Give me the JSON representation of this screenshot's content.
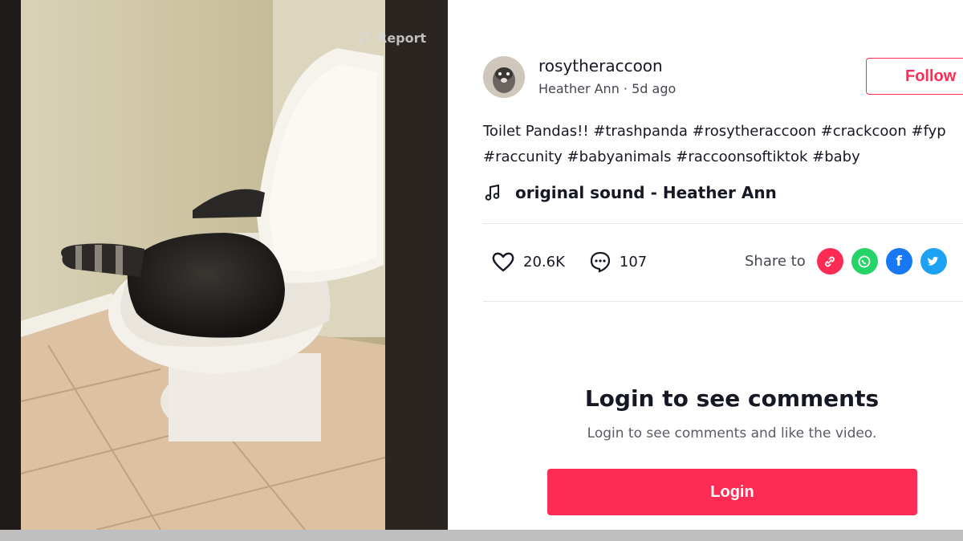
{
  "video": {
    "report_label": "Report"
  },
  "author": {
    "username": "rosytheraccoon",
    "display_name": "Heather Ann",
    "posted": "5d ago",
    "follow_label": "Follow"
  },
  "caption": {
    "line1": "Toilet Pandas!! #trashpanda #rosytheraccoon #crackcoon #fyp",
    "line2": "#raccunity #babyanimals #raccoonsoftiktok #baby"
  },
  "music": {
    "title": "original sound - Heather Ann"
  },
  "stats": {
    "likes": "20.6K",
    "comments": "107"
  },
  "share": {
    "label": "Share to",
    "icons": [
      "link-icon",
      "whatsapp-icon",
      "facebook-icon",
      "twitter-icon"
    ]
  },
  "comments": {
    "title": "Login to see comments",
    "subtitle": "Login to see comments and like the video.",
    "login_label": "Login"
  },
  "colors": {
    "brand": "#fe2c55",
    "whatsapp": "#25d366",
    "facebook": "#1877f2",
    "twitter": "#1da1f2"
  }
}
